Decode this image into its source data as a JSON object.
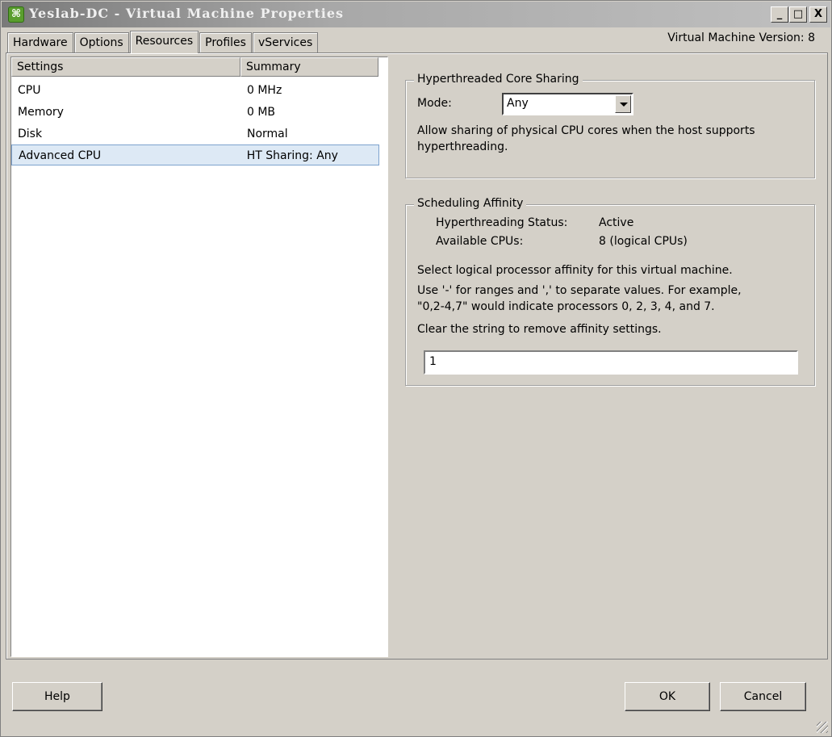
{
  "window": {
    "title": "Yeslab-DC - Virtual Machine Properties",
    "minimize_glyph": "_",
    "maximize_glyph": "□",
    "close_glyph": "X",
    "icon_glyph": "⌘",
    "vm_version": "Virtual Machine Version: 8"
  },
  "tabs": [
    {
      "label": "Hardware",
      "active": false
    },
    {
      "label": "Options",
      "active": false
    },
    {
      "label": "Resources",
      "active": true
    },
    {
      "label": "Profiles",
      "active": false
    },
    {
      "label": "vServices",
      "active": false
    }
  ],
  "settings_list": {
    "columns": [
      "Settings",
      "Summary"
    ],
    "rows": [
      {
        "setting": "CPU",
        "summary": "0 MHz",
        "selected": false
      },
      {
        "setting": "Memory",
        "summary": "0 MB",
        "selected": false
      },
      {
        "setting": "Disk",
        "summary": "Normal",
        "selected": false
      },
      {
        "setting": "Advanced CPU",
        "summary": "HT Sharing: Any",
        "selected": true
      }
    ]
  },
  "ht_sharing": {
    "legend": "Hyperthreaded Core Sharing",
    "mode_label": "Mode:",
    "mode_value": "Any",
    "description_line1": "Allow sharing of physical CPU cores when the host supports",
    "description_line2": "hyperthreading."
  },
  "affinity": {
    "legend": "Scheduling Affinity",
    "ht_status_label": "Hyperthreading Status:",
    "ht_status_value": "Active",
    "cpus_label": "Available CPUs:",
    "cpus_value": "8 (logical CPUs)",
    "instr1": "Select logical processor affinity for this virtual machine.",
    "instr2_line1": "Use '-' for ranges and ',' to separate values. For example,",
    "instr2_line2": "\"0,2-4,7\" would indicate processors 0, 2, 3, 4, and 7.",
    "instr3": "Clear the string to remove affinity settings.",
    "input_value": "1"
  },
  "buttons": {
    "help": "Help",
    "ok": "OK",
    "cancel": "Cancel"
  }
}
